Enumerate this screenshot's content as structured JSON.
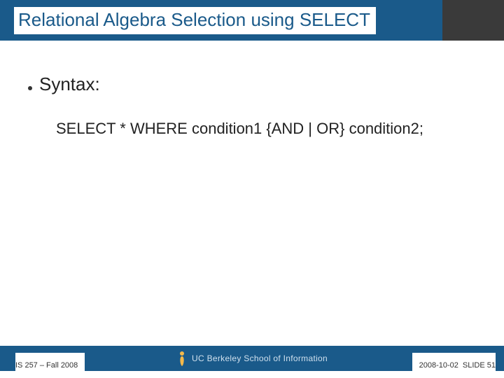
{
  "header": {
    "title": "Relational Algebra Selection using SELECT"
  },
  "body": {
    "bullet_label": "Syntax:",
    "code_line": "SELECT * WHERE condition1 {AND | OR} condition2;"
  },
  "footer": {
    "left": "IS 257 – Fall 2008",
    "center": "UC Berkeley School of Information",
    "right_date": "2008-10-02",
    "right_slide": "SLIDE 51"
  }
}
